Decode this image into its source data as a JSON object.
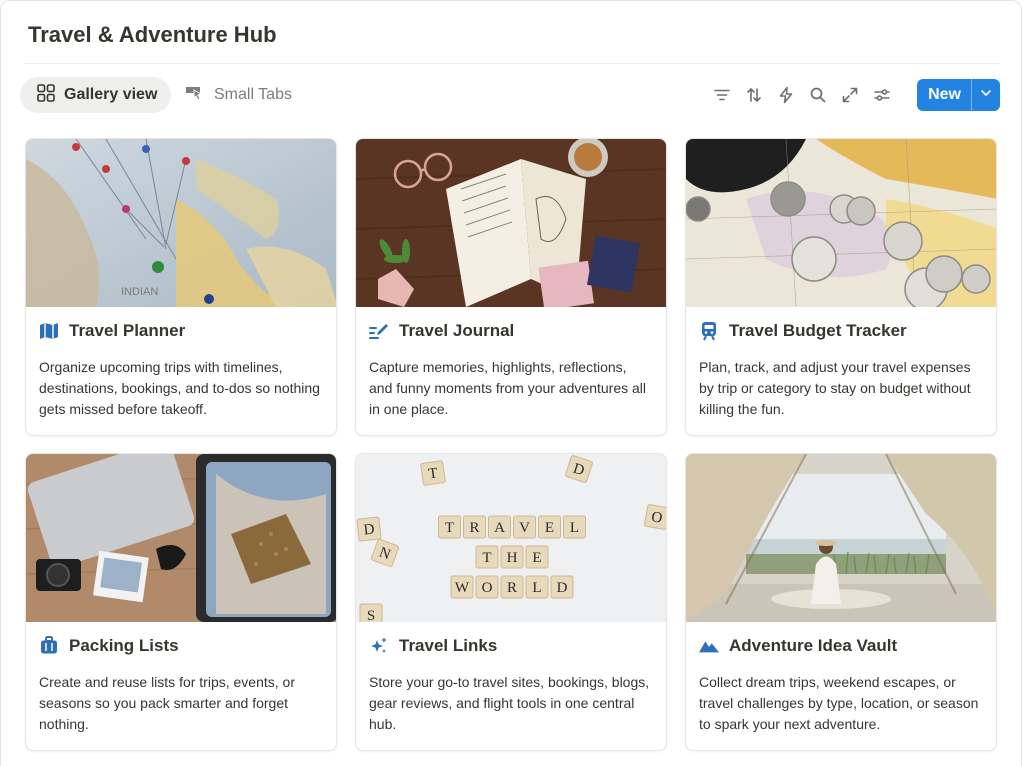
{
  "page": {
    "title": "Travel & Adventure Hub"
  },
  "views": [
    {
      "label": "Gallery view",
      "icon": "grid-icon",
      "active": true
    },
    {
      "label": "Small Tabs",
      "icon": "pointer-tab-icon",
      "active": false
    }
  ],
  "toolbar": {
    "icons": [
      "filter-icon",
      "sort-icon",
      "automation-lightning-icon",
      "search-icon",
      "expand-icon",
      "settings-sliders-icon"
    ],
    "new_label": "New",
    "accent": "#2383e2"
  },
  "cards": [
    {
      "title": "Travel Planner",
      "icon": "map-icon",
      "icon_color": "#2f6fb5",
      "description": "Organize upcoming trips with timelines, destinations, bookings, and to-dos so nothing gets missed before takeoff."
    },
    {
      "title": "Travel Journal",
      "icon": "pen-lines-icon",
      "icon_color": "#2f6fb5",
      "description": "Capture memories, highlights, reflections, and funny moments from your adventures all in one place."
    },
    {
      "title": "Travel Budget Tracker",
      "icon": "train-icon",
      "icon_color": "#2f6fb5",
      "description": "Plan, track, and adjust your travel expenses by trip or category to stay on budget without killing the fun."
    },
    {
      "title": "Packing Lists",
      "icon": "luggage-icon",
      "icon_color": "#2f6fb5",
      "description": "Create and reuse lists for trips, events, or seasons so you pack smarter and forget nothing."
    },
    {
      "title": "Travel Links",
      "icon": "sparkles-icon",
      "icon_color": "#2f6fb5",
      "description": "Store your go-to travel sites, bookings, blogs, gear reviews, and flight tools in one central hub."
    },
    {
      "title": "Adventure Idea Vault",
      "icon": "mountains-icon",
      "icon_color": "#2f6fb5",
      "description": "Collect dream trips, weekend escapes, or travel challenges by type, location, or season to spark your next adventure."
    }
  ],
  "covers": {
    "scrabble_words": [
      "TRAVEL",
      "THE",
      "WORLD"
    ],
    "scrabble_loose": [
      "T",
      "D",
      "O",
      "D",
      "N",
      "S"
    ],
    "map_label": "INDIAN"
  }
}
